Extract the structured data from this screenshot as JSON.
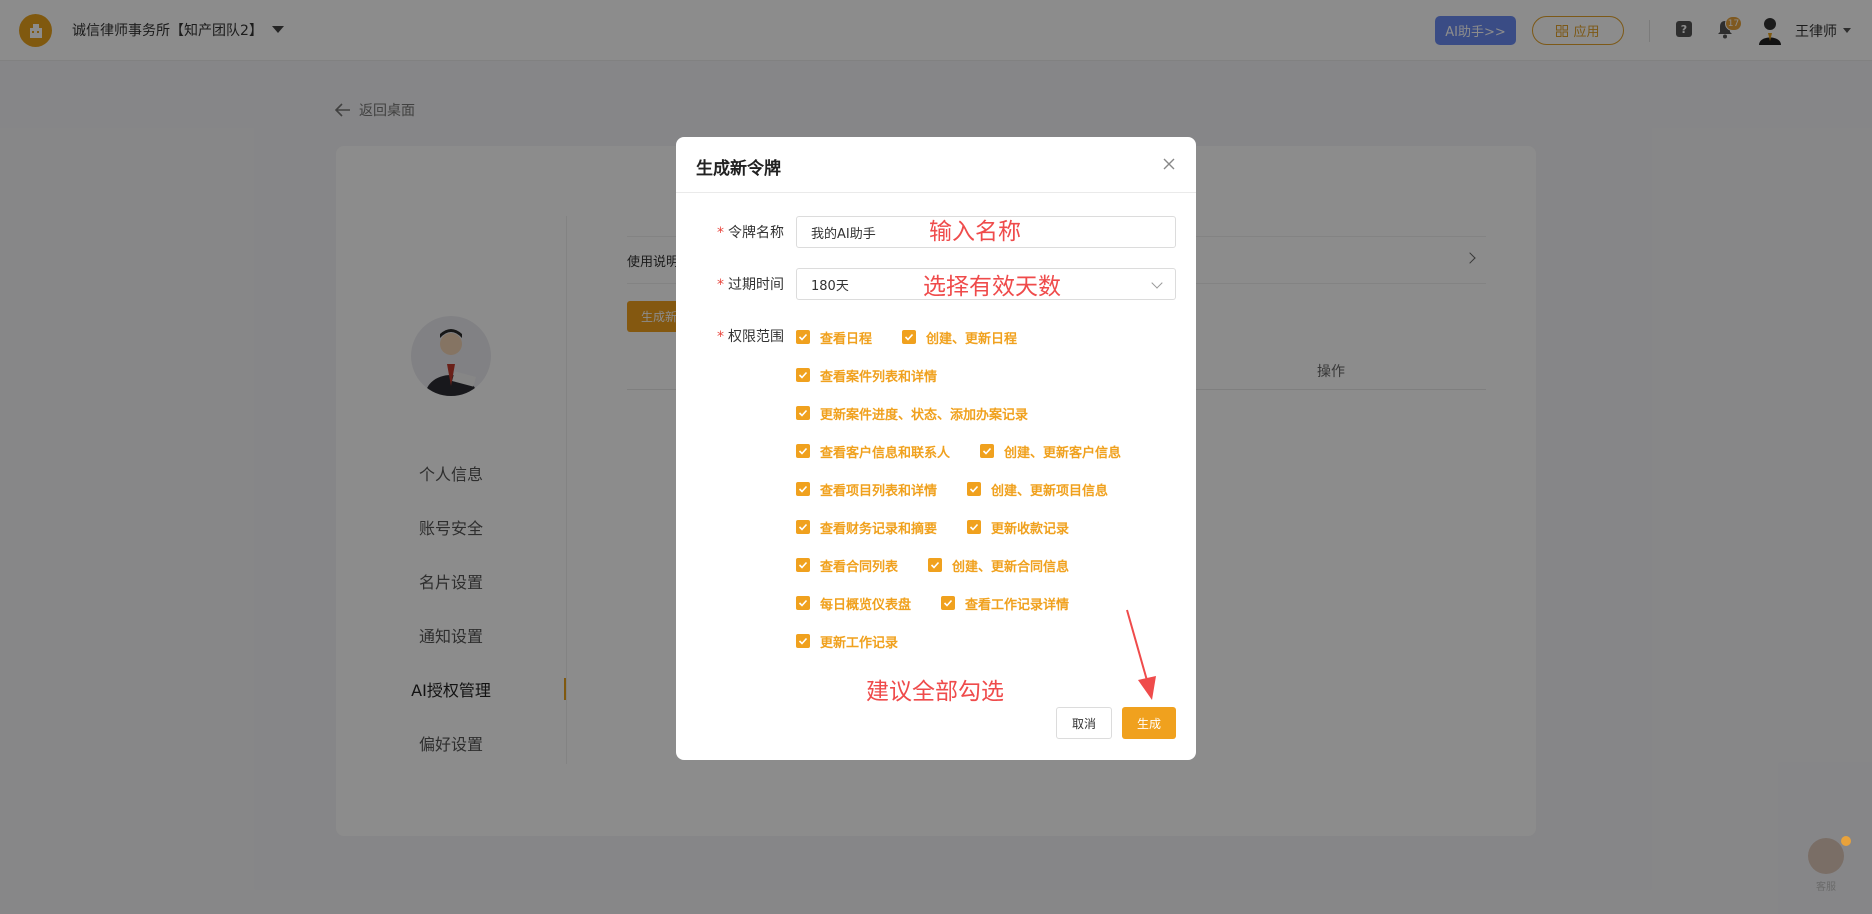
{
  "topbar": {
    "org_name": "诚信律师事务所【知产团队2】",
    "ai_button": "AI助手>>",
    "apps_button": "应用",
    "notification_count": "17",
    "user_name": "王律师"
  },
  "page": {
    "back_label": "返回桌面",
    "side_menu": [
      {
        "label": "个人信息"
      },
      {
        "label": "账号安全"
      },
      {
        "label": "名片设置"
      },
      {
        "label": "通知设置"
      },
      {
        "label": "AI授权管理"
      },
      {
        "label": "偏好设置"
      }
    ],
    "usage_label": "使用说明",
    "generate_button_partial": "生成新",
    "table_ops_header": "操作"
  },
  "modal": {
    "title": "生成新令牌",
    "name_label": "令牌名称",
    "name_value": "我的AI助手",
    "expire_label": "过期时间",
    "expire_value": "180天",
    "scope_label": "权限范围",
    "permissions": [
      [
        "查看日程",
        "创建、更新日程"
      ],
      [
        "查看案件列表和详情"
      ],
      [
        "更新案件进度、状态、添加办案记录"
      ],
      [
        "查看客户信息和联系人",
        "创建、更新客户信息"
      ],
      [
        "查看项目列表和详情",
        "创建、更新项目信息"
      ],
      [
        "查看财务记录和摘要",
        "更新收款记录"
      ],
      [
        "查看合同列表",
        "创建、更新合同信息"
      ],
      [
        "每日概览仪表盘",
        "查看工作记录详情"
      ],
      [
        "更新工作记录"
      ]
    ],
    "cancel_button": "取消",
    "generate_button": "生成"
  },
  "annotations": {
    "name_hint": "输入名称",
    "days_hint": "选择有效天数",
    "select_all_hint": "建议全部勾选"
  },
  "service": {
    "label": "客服"
  },
  "colors": {
    "accent": "#f0a11e",
    "ai_button": "#6a8bf2",
    "annotation": "#ef4b4b"
  }
}
